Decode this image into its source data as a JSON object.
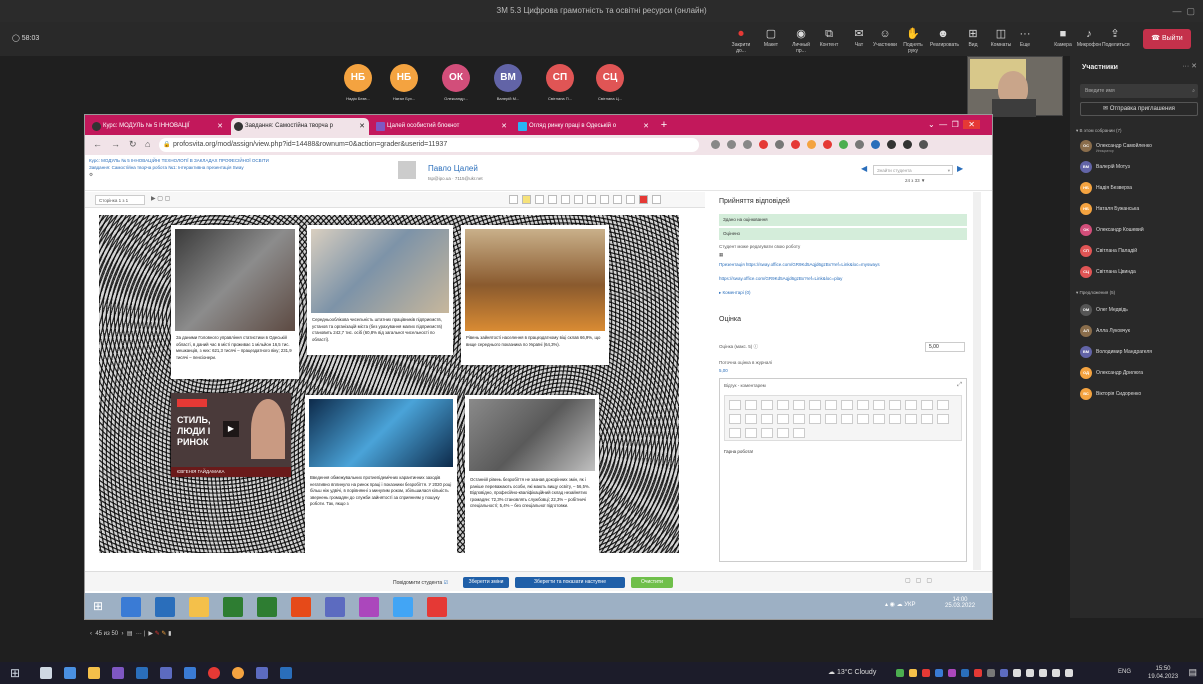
{
  "teams": {
    "window_title": "ЗМ 5.3 Цифрова грамотність та освітні ресурси (онлайн)",
    "timer": "58:03",
    "toolbar": [
      {
        "icon": "record-icon",
        "label": "Закрити до..."
      },
      {
        "icon": "view-icon",
        "label": "Макет"
      },
      {
        "icon": "eye-icon",
        "label": "Личный пр..."
      },
      {
        "icon": "content-icon",
        "label": "Контент"
      },
      {
        "icon": "chat-icon",
        "label": "Чат"
      },
      {
        "icon": "people-icon",
        "label": "Участники"
      },
      {
        "icon": "hand-icon",
        "label": "Поднять руку"
      },
      {
        "icon": "smile-icon",
        "label": "Реагировать"
      },
      {
        "icon": "grid-icon",
        "label": "Вид"
      },
      {
        "icon": "rooms-icon",
        "label": "Комнаты"
      },
      {
        "icon": "more-icon",
        "label": "Еще"
      },
      {
        "icon": "camera-icon",
        "label": "Камера"
      },
      {
        "icon": "mic-icon",
        "label": "Микрофон"
      },
      {
        "icon": "share-icon",
        "label": "Поделиться"
      }
    ],
    "leave_label": "Выйти",
    "avatars": [
      {
        "initials": "НБ",
        "name": "Надія Безв...",
        "color": "#f4a340"
      },
      {
        "initials": "НБ",
        "name": "Натал Бух...",
        "color": "#f4a340"
      },
      {
        "initials": "ОК",
        "name": "Олександр...",
        "color": "#d24e7a"
      },
      {
        "initials": "ВМ",
        "name": "Валерій М...",
        "color": "#6264a7"
      },
      {
        "initials": "СП",
        "name": "Світлана П...",
        "color": "#e05555"
      },
      {
        "initials": "СЦ",
        "name": "Світлана Ц...",
        "color": "#e05555"
      }
    ]
  },
  "panel": {
    "title": "Участники",
    "search_placeholder": "Введите имя",
    "invite_label": "Отправка приглашения",
    "in_meeting_title": "В этом собрании (7)",
    "in_meeting": [
      {
        "initials": "ОС",
        "name": "Олександр Самойленко",
        "role": "Инициатор",
        "color": "#8a6d4b"
      },
      {
        "initials": "ВМ",
        "name": "Валерій Мотуз",
        "role": "",
        "color": "#6264a7"
      },
      {
        "initials": "НБ",
        "name": "Надія Безверха",
        "role": "",
        "color": "#f4a340"
      },
      {
        "initials": "НБ",
        "name": "Наталя Бужанська",
        "role": "",
        "color": "#f4a340"
      },
      {
        "initials": "ОК",
        "name": "Олександр Кошевий",
        "role": "",
        "color": "#d24e7a"
      },
      {
        "initials": "СП",
        "name": "Світлана Паладій",
        "role": "",
        "color": "#e05555"
      },
      {
        "initials": "СЦ",
        "name": "Світлана Цвинда",
        "role": "",
        "color": "#e05555"
      }
    ],
    "suggested_title": "Предложения (5)",
    "suggested": [
      {
        "initials": "ОМ",
        "name": "Олег Медвідь",
        "color": "#555"
      },
      {
        "initials": "АЛ",
        "name": "Алла Луковчук",
        "color": "#8a6d4b"
      },
      {
        "initials": "ВМ",
        "name": "Володимир Мандрагеля",
        "color": "#6264a7"
      },
      {
        "initials": "ОД",
        "name": "Олександр Дрилюга",
        "color": "#f4a340"
      },
      {
        "initials": "ВС",
        "name": "Вікторія Сидоренко",
        "color": "#f4a340"
      }
    ]
  },
  "browser": {
    "tabs": [
      {
        "title": "Курс: МОДУЛЬ № 5 ІННОВАЦІЇ"
      },
      {
        "title": "Завдання: Самостійна творча р"
      },
      {
        "title": "Цалей особистий блокнот"
      },
      {
        "title": "Огляд ринку праці в Одеській о"
      }
    ],
    "url": "profosvita.org/mod/assign/view.php?id=14488&rownum=0&action=grader&userid=11937"
  },
  "moodle": {
    "crumb1": "Курс: МОДУЛЬ № 5 ІННОВАЦІЙНІ ТЕХНОЛОГІЇ В ЗАКЛАДАХ ПРОФЕСІЙНОЇ ОСВІТИ",
    "crumb2": "Завдання: Самостійна творча робота №1: Інтерактивна презентація Sway",
    "user_name": "Павло Цалей",
    "user_email": "tsp@ipo.ua · 7115@ukr.net",
    "student_select": "Знайти студента",
    "counter": "24 з 33",
    "page_select": "Сторінка 1 з 1",
    "cards": [
      {
        "text": "За даними Головного управління статистики в Одеській області, в даний час в місті проживає 1 мільйон 16,5 тис. мешканців, з них: 621,3 тисячі – працездатного віку; 231,9 тисячі – пенсіонери."
      },
      {
        "text": "Середньооблікова чисельність штатних працівників підприємств, установ та організацій міста (без урахування малих підприємств) становить 242,7 тис. осіб (60,8% від загальної чисельності по області)."
      },
      {
        "text": "Рівень зайнятості населення в працездатному віці склав 66,9%, що вище середнього показника по Україні (64,3%)."
      },
      {
        "text": "СТИЛЬ, ЛЮДИ І РИНОК",
        "sub": "ЄВГЕНІЯ ГАЙДАМАКА"
      },
      {
        "text": "Введення обмежувальних протиепідемічних карантинних заходів негативно вплинуло на ринок праці і показники безробіття. У 2020 році більш ніж удвічі, в порівнянні з минулим роком, збільшилася кількість звернень громадян до служби зайнятості за сприянням у пошуку роботи. Так, якщо з"
      },
      {
        "text": "Останній рівень безробіття не зазнав докорінних змін, як і раніше переважають особи, які мають вищу освіту, – 56,5%. Відповідно, професійно-кваліфікаційний склад незайнятих громадян: 72,3% становлять службовці; 22,3% – робітничі спеціальності; 5,4% – без спеціальної підготовки."
      }
    ],
    "grade_panel": {
      "submission_title": "Прийняття відповідей",
      "status1": "Здано на оцінювання",
      "status2": "Оцінено",
      "edit_note": "Студент може редагувати свою роботу",
      "link1": "Презентація https://sway.office.com/GR9Kd5Aqjd6gzBx?ref=Link&loc=mysways",
      "link2": "https://sway.office.com/GR9Kd5Aqjd6gzBx?ref=Link&loc=play",
      "comments": "Коментарі (0)",
      "grade_title": "Оцінка",
      "grade_label": "Оцінка (макс. 5)",
      "grade_value": "5,00",
      "current_label": "Поточна оцінка в журналі",
      "current_value": "5,00",
      "feedback_label": "Відгук - коментарем",
      "feedback_text": "Гарна робота!"
    },
    "bottom": {
      "notify_label": "Повідомити студента",
      "save_label": "Зберегти зміни",
      "save_next_label": "Зберегти та показати наступне",
      "reset_label": "Очистити"
    }
  },
  "inner_taskbar": {
    "lang": "УКР",
    "time": "14:00",
    "date": "25.03.2022"
  },
  "pres_nav": {
    "page": "45 из 50"
  },
  "host_taskbar": {
    "weather": "13°C  Cloudy",
    "lang": "ENG",
    "time": "15:50",
    "date": "19.04.2023"
  }
}
